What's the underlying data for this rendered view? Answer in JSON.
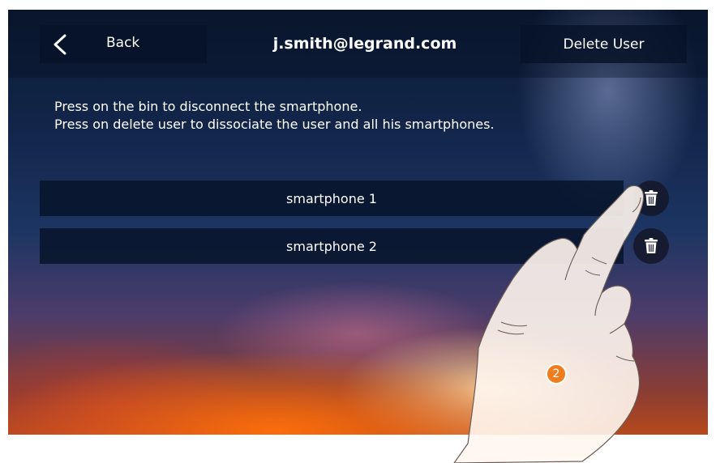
{
  "header": {
    "back_label": "Back",
    "title": "j.smith@legrand.com",
    "delete_user_label": "Delete User"
  },
  "instructions": {
    "line1": "Press on the bin to disconnect the smartphone.",
    "line2": "Press on delete user to dissociate the user and all his smartphones."
  },
  "devices": [
    {
      "label": "smartphone 1",
      "action_icon": "bin-icon"
    },
    {
      "label": "smartphone 2",
      "action_icon": "bin-icon"
    }
  ],
  "step_badge": "2",
  "colors": {
    "panel": "#061228",
    "badge": "#f07d1d",
    "text": "#ffffff"
  }
}
